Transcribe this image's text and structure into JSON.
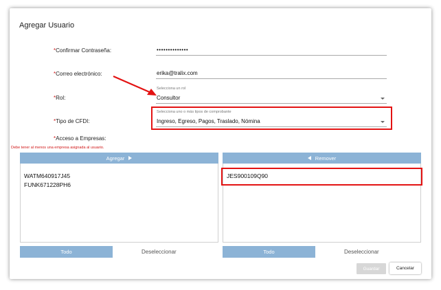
{
  "dialog": {
    "title": "Agregar Usuario"
  },
  "form": {
    "confirm_password": {
      "label": "Confirmar Contraseña:",
      "value": "••••••••••••••"
    },
    "email": {
      "label": "Correo electrónico:",
      "value": "erika@tralix.com"
    },
    "role": {
      "label": "Rol:",
      "hint": "Selecciona un rol",
      "value": "Consultor"
    },
    "cfdi_type": {
      "label": "Tipo de CFDI:",
      "hint": "Selecciona uno o más tipos de comprobante",
      "value": "Ingreso, Egreso, Pagos, Traslado, Nómina"
    },
    "companies_access": {
      "label": "Acceso a Empresas:"
    },
    "required_mark": "*"
  },
  "error_text": "Debe tener al menos una empresa asignada al usuario.",
  "available": {
    "header": "Agregar",
    "items": [
      "WATM640917J45",
      "FUNK671228PH6"
    ],
    "all_button": "Todo",
    "deselect_button": "Deseleccionar"
  },
  "assigned": {
    "header": "Remover",
    "items": [
      "JES900109Q90"
    ],
    "all_button": "Todo",
    "deselect_button": "Deseleccionar"
  },
  "actions": {
    "save": "Guardar",
    "cancel": "Cancelar"
  },
  "colors": {
    "primary": "#8cb3d6",
    "required": "#d01616",
    "highlight": "#e31212",
    "disabled": "#d7d7d7"
  },
  "icons": {
    "add": "triangle-right-icon",
    "remove": "triangle-left-icon",
    "dropdown": "caret-down-icon",
    "annotation": "red-arrow-icon"
  }
}
